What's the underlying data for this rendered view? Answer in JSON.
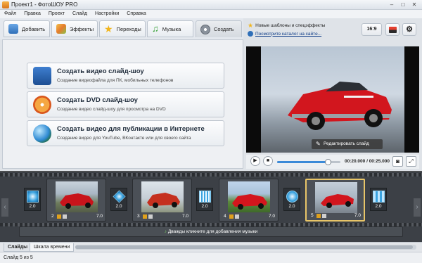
{
  "window": {
    "title": "Проект1 - ФотоШОУ PRO",
    "minimize": "–",
    "maximize": "□",
    "close": "✕"
  },
  "menu": [
    "Файл",
    "Правка",
    "Проект",
    "Слайд",
    "Настройки",
    "Справка"
  ],
  "tabs": [
    {
      "label": "Добавить",
      "icon": "add-icon"
    },
    {
      "label": "Эффекты",
      "icon": "effects-icon"
    },
    {
      "label": "Переходы",
      "icon": "star-icon"
    },
    {
      "label": "Музыка",
      "icon": "music-icon"
    },
    {
      "label": "Создать",
      "icon": "film-reel-icon",
      "active": true
    }
  ],
  "create_options": [
    {
      "title": "Создать видео слайд-шоу",
      "subtitle": "Создание видеофайла для ПК, мобильных телефонов",
      "icon": "video-phone-icon"
    },
    {
      "title": "Создать DVD слайд-шоу",
      "subtitle": "Создание видео слайд-шоу для просмотра на DVD",
      "icon": "dvd-icon"
    },
    {
      "title": "Создать видео для публикации в Интернете",
      "subtitle": "Создание видео для YouTube, ВКонтакте или для своего сайта",
      "icon": "globe-icon"
    }
  ],
  "notices": {
    "templates": "Новые шаблоны и спецэффекты",
    "catalog_link": "Посмотрите каталог на сайте..."
  },
  "aspect_ratio": "16:9",
  "preview": {
    "edit_label": "Редактировать слайд"
  },
  "player": {
    "time": "00:20.000 / 00:25.000",
    "progress": 0.8
  },
  "timeline": {
    "slides": [
      {
        "num": "2",
        "duration": "7.0"
      },
      {
        "num": "3",
        "duration": "7.0"
      },
      {
        "num": "4",
        "duration": "7.0"
      },
      {
        "num": "5",
        "duration": "7.0",
        "selected": true
      }
    ],
    "transitions": [
      "2.0",
      "2.0",
      "2.0",
      "2.0",
      "2.0"
    ],
    "music_hint": "Дважды кликните для добавления музыки"
  },
  "bottom_tabs": [
    "Слайды",
    "Шкала времени"
  ],
  "status": "Слайд 5 из 5",
  "colors": {
    "accent": "#e8c568",
    "link": "#0b3a86",
    "timeline_bg": "#3c4046",
    "car_red": "#d2161e"
  }
}
